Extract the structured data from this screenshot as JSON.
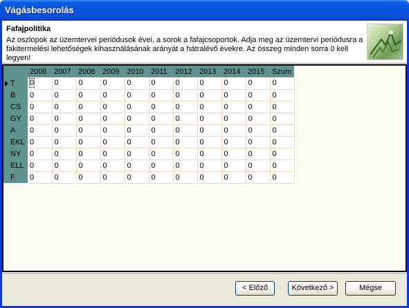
{
  "window": {
    "title": "Vágásbesorolás"
  },
  "header": {
    "title": "Fafajpolitika",
    "description": "Az oszlopok az üzemtervei periódusok évei, a sorok a fafajcsoportok. Adja meg az üzemtervi periódusra a fakitermelési lehetőségek kihasználásának arányát a hátralévő évekre. Az összeg minden sorra 0 kell legyen!",
    "logo_icon": "forest-logo-icon"
  },
  "grid": {
    "columns": [
      "2006",
      "2007",
      "2008",
      "2009",
      "2010",
      "2011",
      "2012",
      "2013",
      "2014",
      "2015",
      "Szum"
    ],
    "rows": [
      {
        "label": "T",
        "values": [
          "0",
          "0",
          "0",
          "0",
          "0",
          "0",
          "0",
          "0",
          "0",
          "0",
          "0"
        ]
      },
      {
        "label": "B",
        "values": [
          "0",
          "0",
          "0",
          "0",
          "0",
          "0",
          "0",
          "0",
          "0",
          "0",
          "0"
        ]
      },
      {
        "label": "CS",
        "values": [
          "0",
          "0",
          "0",
          "0",
          "0",
          "0",
          "0",
          "0",
          "0",
          "0",
          "0"
        ]
      },
      {
        "label": "GY",
        "values": [
          "0",
          "0",
          "0",
          "0",
          "0",
          "0",
          "0",
          "0",
          "0",
          "0",
          "0"
        ]
      },
      {
        "label": "A",
        "values": [
          "0",
          "0",
          "0",
          "0",
          "0",
          "0",
          "0",
          "0",
          "0",
          "0",
          "0"
        ]
      },
      {
        "label": "EKL",
        "values": [
          "0",
          "0",
          "0",
          "0",
          "0",
          "0",
          "0",
          "0",
          "0",
          "0",
          "0"
        ]
      },
      {
        "label": "NY",
        "values": [
          "0",
          "0",
          "0",
          "0",
          "0",
          "0",
          "0",
          "0",
          "0",
          "0",
          "0"
        ]
      },
      {
        "label": "ELL",
        "values": [
          "0",
          "0",
          "0",
          "0",
          "0",
          "0",
          "0",
          "0",
          "0",
          "0",
          "0"
        ]
      },
      {
        "label": "F",
        "values": [
          "0",
          "0",
          "0",
          "0",
          "0",
          "0",
          "0",
          "0",
          "0",
          "0",
          "0"
        ]
      }
    ]
  },
  "buttons": {
    "prev": "< Előző",
    "next": "Következő >",
    "cancel": "Mégse"
  },
  "colors": {
    "header_bg": "#5f9390",
    "titlebar": "#0a4fd8",
    "grid_bg": "#fdfcf2"
  }
}
